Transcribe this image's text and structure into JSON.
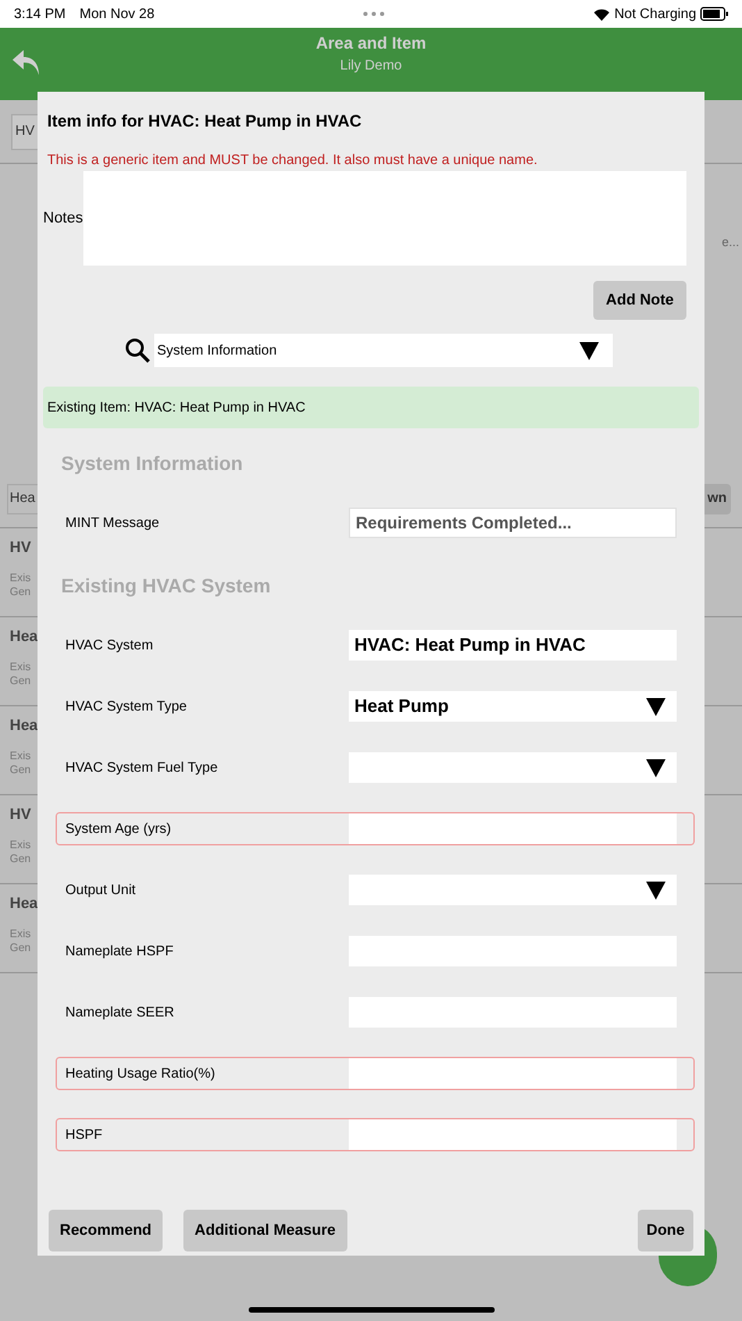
{
  "status_bar": {
    "time": "3:14 PM",
    "date": "Mon Nov 28",
    "charging": "Not Charging"
  },
  "header": {
    "title": "Area and Item",
    "subtitle": "Lily Demo"
  },
  "background": {
    "top_field": "HV",
    "side_label": "e...",
    "filter_field": "Hea",
    "filter_button": "wn",
    "items": [
      {
        "title": "HV",
        "lines": [
          "Exis",
          "Gen"
        ]
      },
      {
        "title": "Hea",
        "lines": [
          "Exis",
          "Gen"
        ]
      },
      {
        "title": "Hea",
        "lines": [
          "Exis",
          "Gen"
        ]
      },
      {
        "title": "HV",
        "lines": [
          "Exis",
          "Gen"
        ]
      },
      {
        "title": "Hea",
        "lines": [
          "Exis",
          "Gen"
        ]
      }
    ]
  },
  "dialog": {
    "title": "Item info for HVAC: Heat Pump in HVAC",
    "warning": "This is a generic item and MUST be changed. It also must have a unique name.",
    "notes": {
      "label": "Notes"
    },
    "add_note": "Add Note",
    "section_picker": "System Information",
    "existing_item": "Existing Item: HVAC: Heat Pump in HVAC",
    "form": [
      {
        "kind": "heading",
        "label": "System Information"
      },
      {
        "kind": "readonly",
        "label": "MINT Message",
        "value": "Requirements Completed...",
        "required": false
      },
      {
        "kind": "heading",
        "label": "Existing HVAC System"
      },
      {
        "kind": "text",
        "label": "HVAC System",
        "value": "HVAC: Heat Pump in HVAC",
        "required": false
      },
      {
        "kind": "select",
        "label": "HVAC System Type",
        "value": "Heat Pump",
        "required": false
      },
      {
        "kind": "select",
        "label": "HVAC System Fuel Type",
        "required": false
      },
      {
        "kind": "text",
        "label": "System Age (yrs)",
        "required": true
      },
      {
        "kind": "select",
        "label": "Output Unit",
        "required": false
      },
      {
        "kind": "text",
        "label": "Nameplate HSPF",
        "required": false
      },
      {
        "kind": "text",
        "label": "Nameplate SEER",
        "required": false
      },
      {
        "kind": "text",
        "label": "Heating Usage Ratio(%)",
        "required": true
      },
      {
        "kind": "text",
        "label": "HSPF",
        "required": true
      }
    ],
    "buttons": [
      "Recommend",
      "Additional Measure"
    ],
    "done": "Done"
  }
}
